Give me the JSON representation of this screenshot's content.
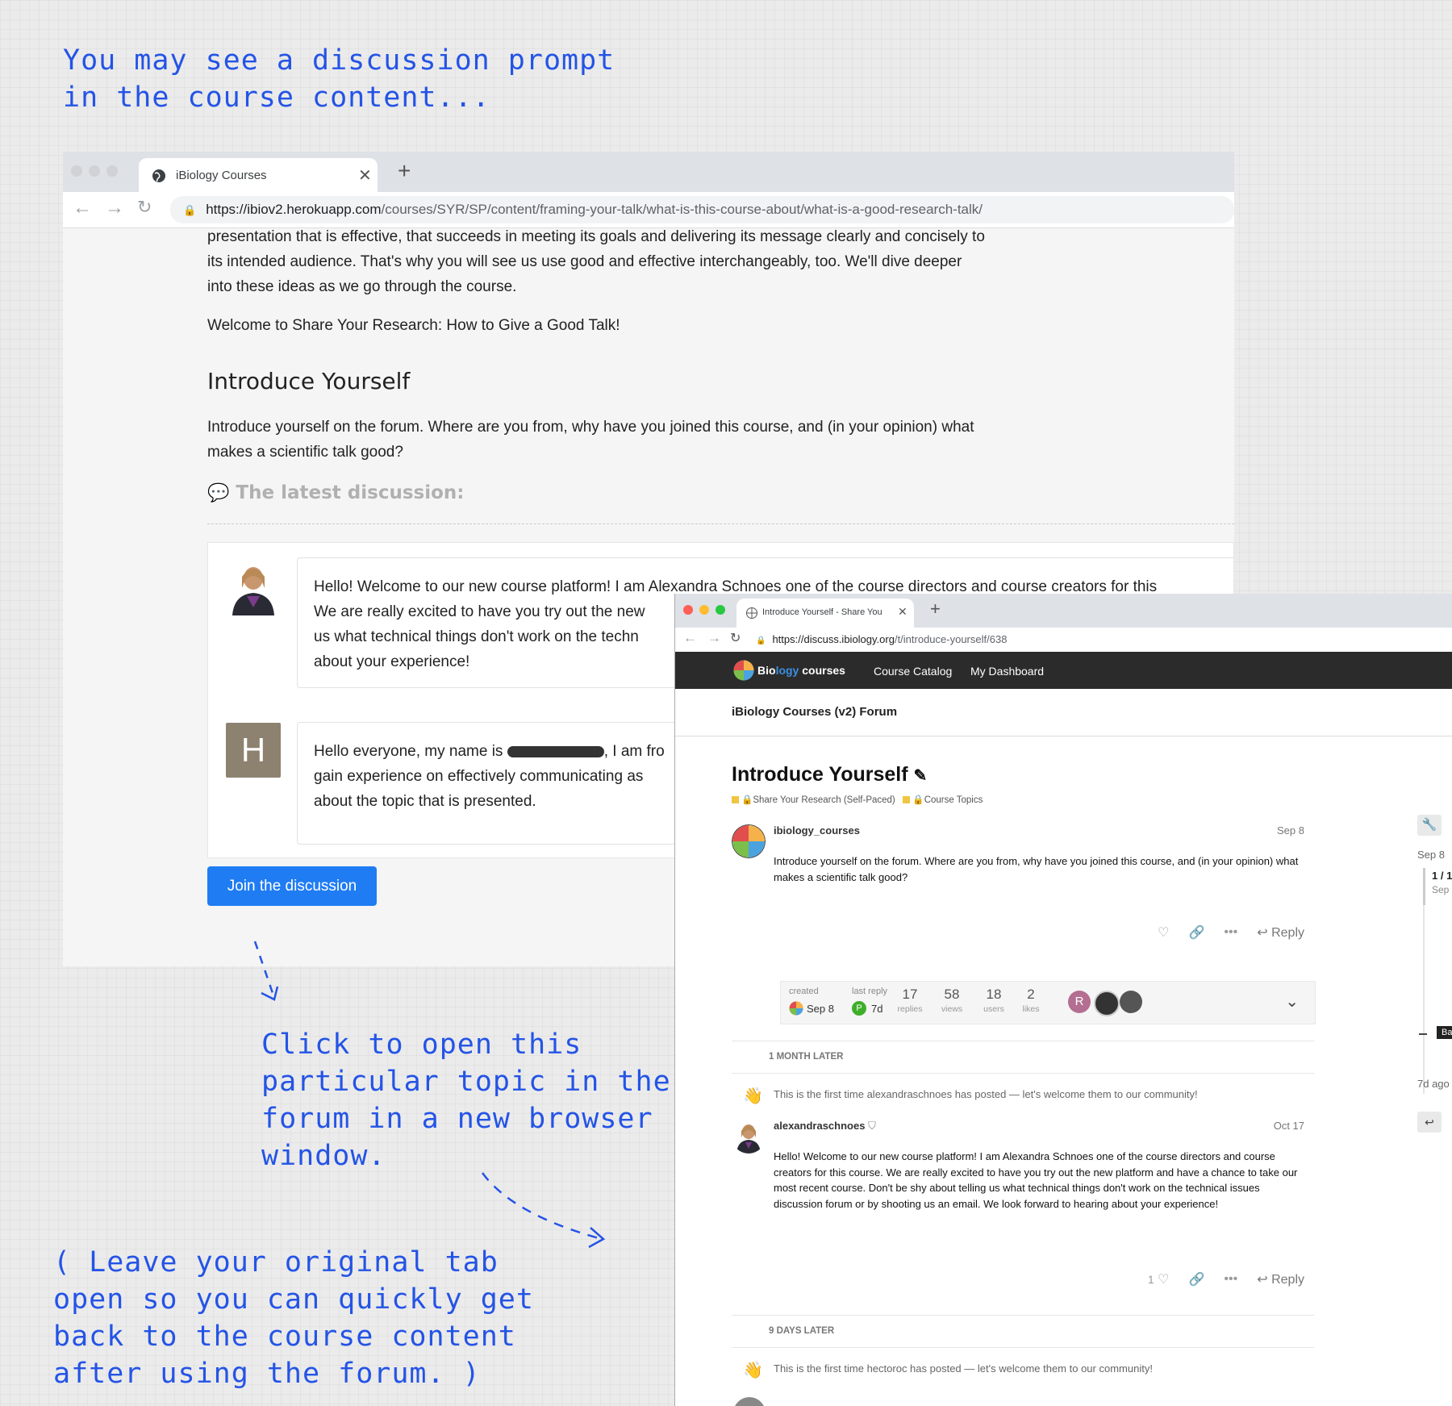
{
  "notes": {
    "top": [
      "You may see a discussion prompt",
      "in the course content..."
    ],
    "middle": [
      "Click to open this",
      "particular topic in the",
      "forum in a new browser",
      "window."
    ],
    "bottom": [
      "( Leave your original tab",
      "open so you can quickly get",
      "back to the course content",
      "after using the forum. )"
    ]
  },
  "window1": {
    "tab_title": "iBiology Courses",
    "url_host": "https://ibiov2.herokuapp.com",
    "url_path": "/courses/SYR/SP/content/framing-your-talk/what-is-this-course-about/what-is-a-good-research-talk/",
    "paragraph1": [
      "presentation that is effective, that succeeds in meeting its goals and delivering its message clearly and concisely to",
      "its intended audience. That's why you will see us use good and effective interchangeably, too. We'll dive deeper",
      "into these ideas as we go through the course."
    ],
    "welcome": "Welcome to Share Your Research: How to Give a Good Talk!",
    "heading": "Introduce Yourself",
    "prompt": [
      "Introduce yourself on the forum. Where are you from, why have you joined this course, and (in your opinion) what",
      "makes a scientific talk good?"
    ],
    "latest_label": "The latest discussion:",
    "post1_lines": [
      "Hello! Welcome to our new course platform! I am Alexandra Schnoes one of the course directors and course creators for this",
      "We are really excited to have you try out the new",
      "us what technical things don't work on the techn",
      "about your experience!"
    ],
    "post2_avatar_letter": "H",
    "post2_prefix": "Hello everyone, my name is",
    "post2_suffix": ", I am fro",
    "post2_lines": [
      "gain experience on effectively communicating as",
      "about the topic that is presented."
    ],
    "join_button": "Join the discussion"
  },
  "window2": {
    "tab_title": "Introduce Yourself - Share You",
    "url_host": "https://discuss.ibiology.org",
    "url_path": "/t/introduce-yourself/638",
    "brand_prefix": "Bio",
    "brand_mid": "logy",
    "brand_suffix": " courses",
    "nav": [
      "Course Catalog",
      "My Dashboard"
    ],
    "forum_name": "iBiology Courses (v2) Forum",
    "topic_title": "Introduce Yourself",
    "categories": [
      "Share Your Research (Self-Paced)",
      "Course Topics"
    ],
    "first_post": {
      "user": "ibiology_courses",
      "date": "Sep 8",
      "body": "Introduce yourself on the forum. Where are you from, why have you joined this course, and (in your opinion) what makes a scientific talk good?",
      "reply": "Reply"
    },
    "topic_map": {
      "created_label": "created",
      "created_value": "Sep 8",
      "last_reply_label": "last reply",
      "last_reply_value": "7d",
      "last_reply_avatar": "P",
      "stats": [
        {
          "value": "17",
          "label": "replies"
        },
        {
          "value": "58",
          "label": "views"
        },
        {
          "value": "18",
          "label": "users"
        },
        {
          "value": "2",
          "label": "likes"
        }
      ],
      "participant_avatar": "R"
    },
    "gap1": "1 MONTH LATER",
    "first_time_1": "This is the first time alexandraschnoes has posted — let's welcome them to our community!",
    "second_post": {
      "user": "alexandraschnoes",
      "date": "Oct 17",
      "body": "Hello! Welcome to our new course platform! I am Alexandra Schnoes one of the course directors and course creators for this course. We are really excited to have you try out the new platform and have a chance to take our most recent course. Don't be shy about telling us what technical things don't work on the technical issues discussion forum or by shooting us an email. We look forward to hearing about your experience!",
      "likes": "1",
      "reply": "Reply"
    },
    "gap2": "9 DAYS LATER",
    "first_time_2": "This is the first time hectoroc has posted — let's welcome them to our community!",
    "timeline": {
      "top_date": "Sep 8",
      "progress": "1 / 1",
      "progress_sub": "Sep",
      "bottom": "7d ago",
      "back": "Ba"
    }
  }
}
